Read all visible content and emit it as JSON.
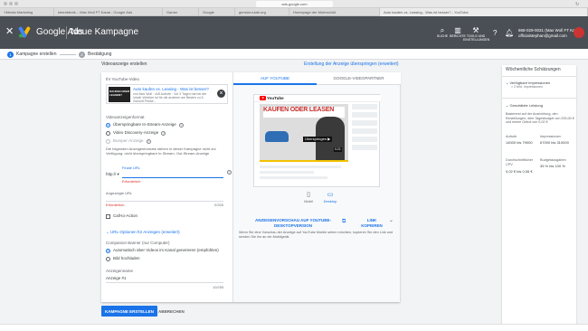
{
  "browser": {
    "url": "ads.google.com",
    "tabs": [
      "YMedia Marketing",
      "Ideenfabrik – Max Woll FT Kanal - Google Ads",
      "Gamer",
      "Google",
      "gimstar.rulab.org",
      "Homepage der Mohrschild",
      "Auto kaufen vs. Leasing - Was ist besser? - YouTube"
    ]
  },
  "header": {
    "brand": "Google Ads",
    "campaign_title": "Neue Kampagne",
    "tools": [
      {
        "label": "SUCHE",
        "icon": "search-icon"
      },
      {
        "label": "BERICHTE",
        "icon": "reports-icon"
      },
      {
        "label": "TOOLS UND EINSTELLUNGEN",
        "icon": "tools-icon"
      }
    ],
    "account_id": "868-029-0031 (Max Woll FT Ka...",
    "account_email": "officialstephan@gmail.com"
  },
  "stepper": {
    "steps": [
      {
        "num": "1",
        "label": "Kampagne erstellen"
      },
      {
        "num": "2",
        "label": "Bestätigung"
      }
    ]
  },
  "card": {
    "title": "Videoanzeige erstellen",
    "top_link": "Erstellung der Anzeige überspringen (erweitert)",
    "video_label": "Ihr YouTube-Video",
    "video": {
      "title": "Auto kaufen vs. Leasing - Was ist besser?",
      "meta": "von Max Woll · 445 Aufrufe · Vor 3 Tagen hat bei der Inhalt: Welcher ist für die anderen am Besten zu 5 Zukunft Preise...",
      "thumb_text": "KAUFEN ODER LEASEN?"
    },
    "format_label": "Videoanzeigenformat",
    "formats": [
      {
        "label": "Überspringbare In-Stream-Anzeige",
        "selected": true,
        "disabled": false
      },
      {
        "label": "Video Discovery-Anzeige",
        "selected": false,
        "disabled": false
      },
      {
        "label": "Bumper-Anzeige",
        "selected": false,
        "disabled": true
      }
    ],
    "format_desc": "Die folgenden Anzeigenformate stehen in dieser Kampagne nicht zur Verfügung: nicht überspringbare In-Stream, Out-Stream-Anzeige",
    "final_url_label": "Finale URL",
    "url_prefix": "http:// ▾",
    "final_url_value": "",
    "final_url_error": "Erforderlich",
    "display_url_label": "Angezeigte URL",
    "display_url_value": "",
    "display_url_error": "Erforderlich",
    "display_url_count": "0/255",
    "cta_label": "Call-to-Action",
    "url_options_label": "URL-Optionen für Anzeigen (erweitert)",
    "companion_label": "Companion Banner (nur Computer)",
    "companion_options": [
      {
        "label": "Automatisch über Videos im Kanal generieren (empfohlen)",
        "selected": true
      },
      {
        "label": "Bild hochladen",
        "selected": false
      }
    ],
    "adname_label": "Anzeigenname",
    "adname_value": "Anzeige #1",
    "adname_count": "10/255"
  },
  "preview": {
    "tabs": [
      "AUF YOUTUBE",
      "GOOGLE-VIDEOPARTNER"
    ],
    "yt_logo": "YouTube",
    "video_headline": "KAUFEN ODER LEASEN",
    "video_badge": "Überspringen ▶",
    "video_duration": "0:21",
    "devices": [
      {
        "label": "Mobil",
        "icon": "mobile-icon"
      },
      {
        "label": "Desktop",
        "icon": "desktop-icon"
      }
    ],
    "preview_link": "ANZEIGENVORSCHAU AUF YOUTUBE-DESKTOPVERSION",
    "copy_link": "LINK KOPIEREN",
    "note": "Wenn Sie eine Vorschau der Anzeige auf YouTube Mobile sehen möchten, kopieren Sie den Link und senden Sie ihn an ein Mobilgerät."
  },
  "buttons": {
    "create": "KAMPAGNE ERSTELLEN",
    "cancel": "ABBRECHEN"
  },
  "estimates": {
    "title": "Wöchentliche Schätzungen",
    "impressions_label": "Verfügbare Impressionen",
    "impressions_value": "> 2 Mrd. Impressionen",
    "perf_label": "Geschätzte Leistung",
    "perf_desc": "Basierend auf der Ausrichtung, den Einstellungen, dem Tagesbudget von 200,00 € und einem Gebot von 0,02 €",
    "views_label": "Aufrufe",
    "views_value": "14000 bis 79000",
    "impr_label": "Impressionen",
    "impr_value": "67000 bis 310000",
    "cpv_label": "Durchschnittlicher CPV",
    "cpv_value": "0,02 € bis 0,06 €",
    "budget_label": "Budgetausgaben",
    "budget_value": "35 % bis 100 %"
  }
}
